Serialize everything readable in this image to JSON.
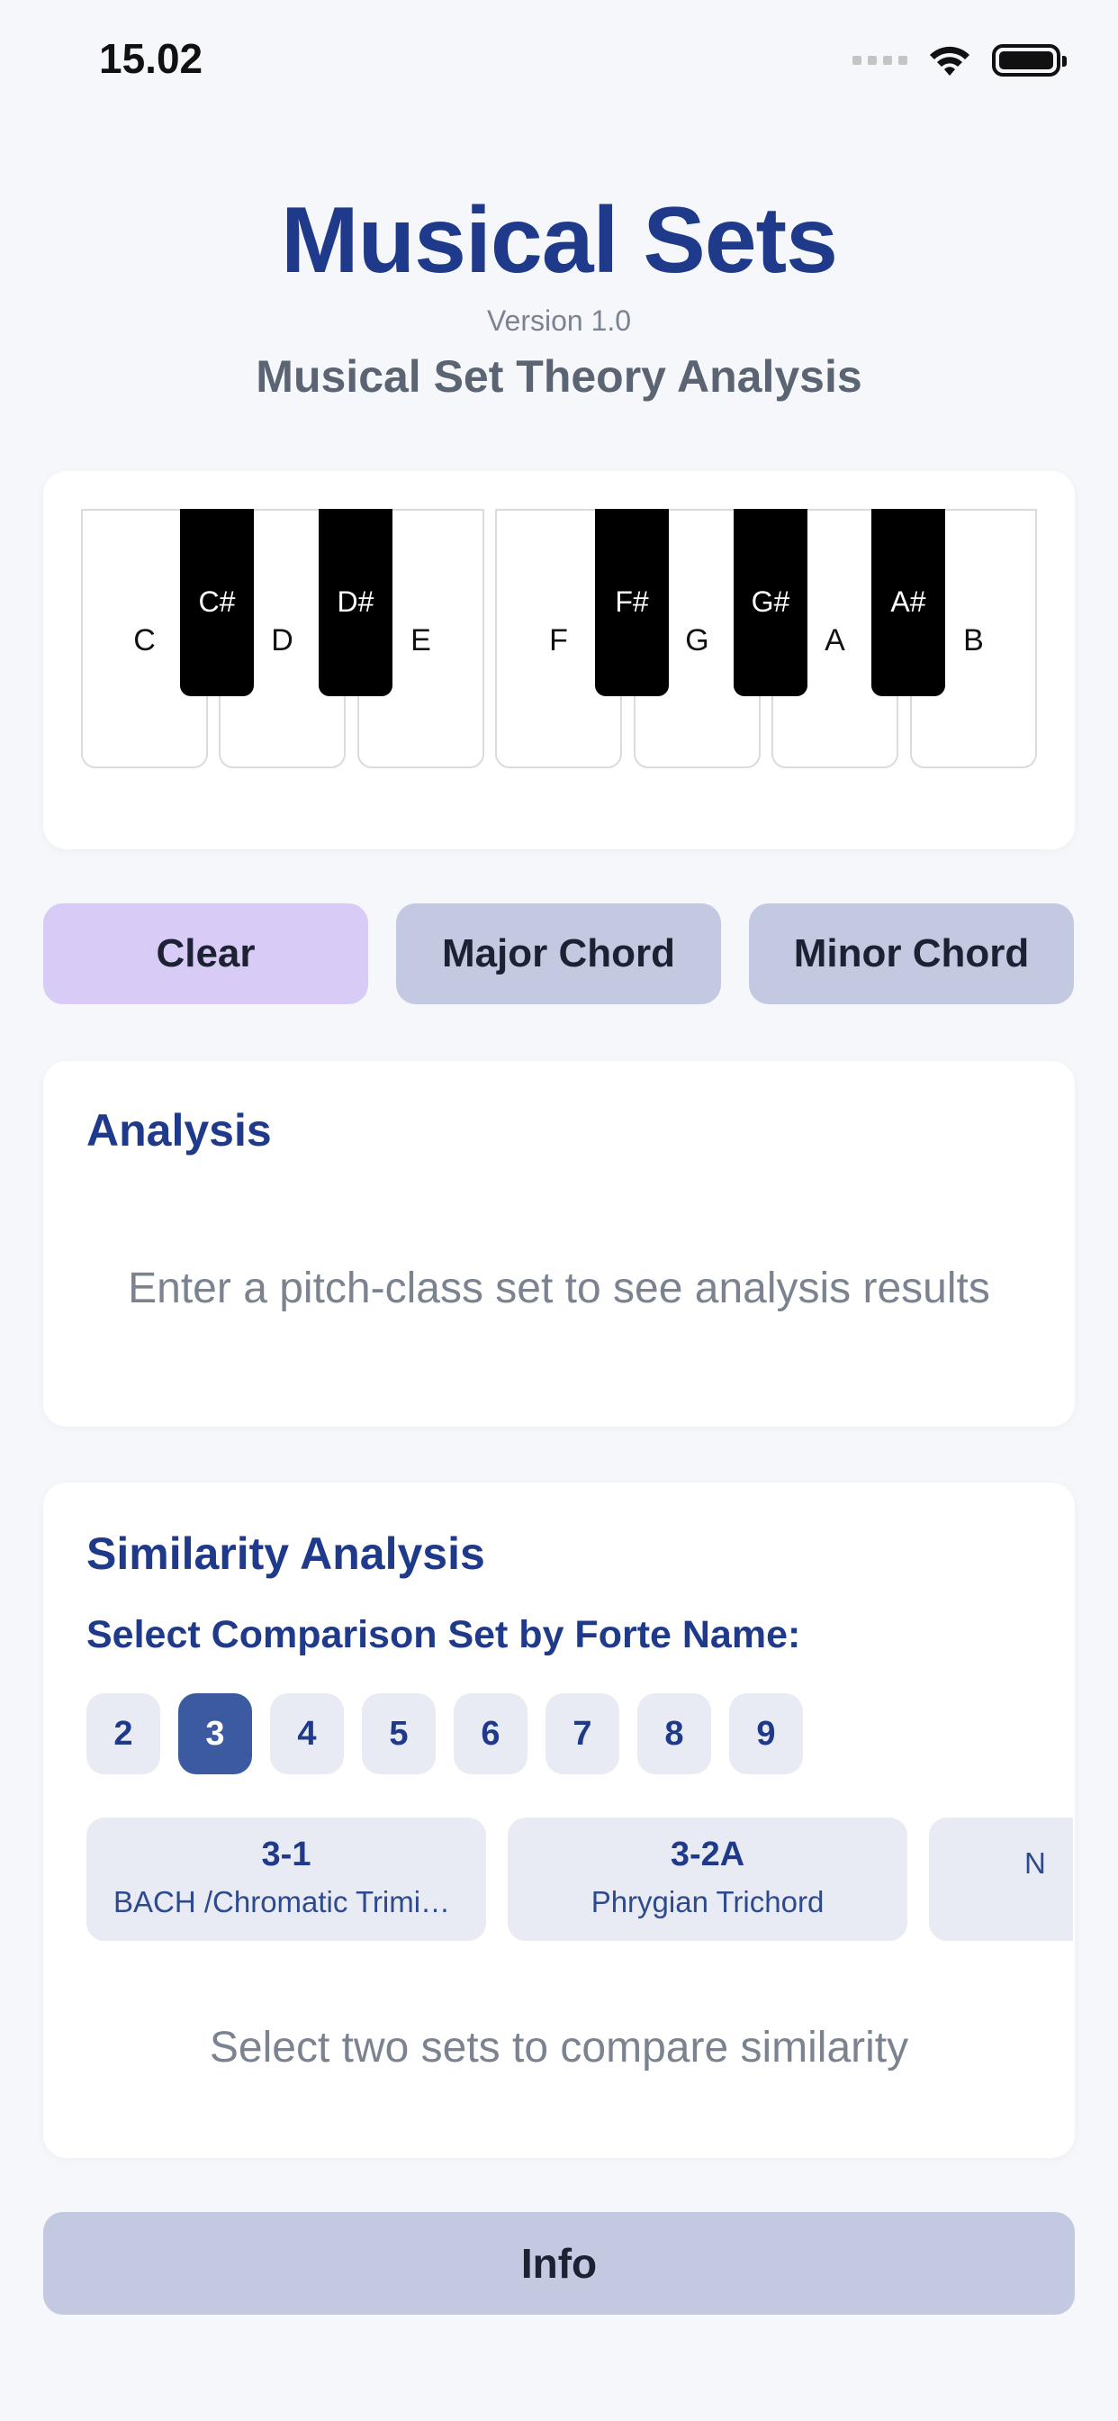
{
  "status": {
    "time": "15.02"
  },
  "header": {
    "title": "Musical Sets",
    "version": "Version 1.0",
    "subtitle": "Musical Set Theory Analysis"
  },
  "piano": {
    "white_keys": [
      "C",
      "D",
      "E",
      "F",
      "G",
      "A",
      "B"
    ],
    "black_keys": [
      "C#",
      "D#",
      "F#",
      "G#",
      "A#"
    ]
  },
  "actions": {
    "clear": "Clear",
    "major": "Major Chord",
    "minor": "Minor Chord"
  },
  "analysis": {
    "title": "Analysis",
    "empty": "Enter a pitch-class set to see analysis results"
  },
  "similarity": {
    "title": "Similarity Analysis",
    "label": "Select Comparison Set by Forte Name:",
    "numbers": [
      "2",
      "3",
      "4",
      "5",
      "6",
      "7",
      "8",
      "9"
    ],
    "selected_number": "3",
    "sets": [
      {
        "name": "3-1",
        "desc": "BACH /Chromatic Trimirror"
      },
      {
        "name": "3-2A",
        "desc": "Phrygian Trichord"
      },
      {
        "name": "",
        "desc": "N"
      }
    ],
    "empty": "Select two sets to compare similarity"
  },
  "info": {
    "label": "Info"
  },
  "colors": {
    "title": "#1f3a8a",
    "clear_button": "#d8ccf7",
    "secondary_button": "#c3c9e0",
    "selected_chip": "#3b5aa0"
  }
}
